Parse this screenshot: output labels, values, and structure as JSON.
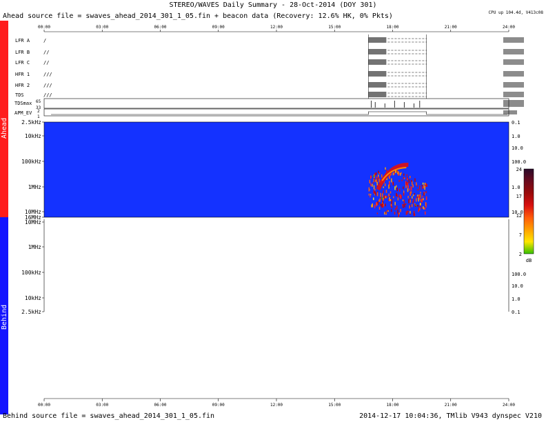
{
  "title": "STEREO/WAVES Daily Summary - 28-Oct-2014 (DOY 301)",
  "ahead_source": "Ahead source file = swaves_ahead_2014_301_1_05.fin + beacon data (Recovery: 12.6% HK,   0% Pkts)",
  "behind_source": "Behind source file = swaves_ahead_2014_301_1_05.fin",
  "footer_right": "2014-12-17 10:04:36, TMlib V943 dynspec V210",
  "cpu_info": "CPU up 104.4d, V413c08",
  "sidebar": {
    "ahead": "Ahead",
    "behind": "Behind",
    "ahead_color": "#ff1c1c",
    "behind_color": "#1414ff"
  },
  "time_ticks": [
    "00:00",
    "03:00",
    "06:00",
    "09:00",
    "12:00",
    "15:00",
    "18:00",
    "21:00",
    "24:00"
  ],
  "hk_rows": [
    {
      "label": "LFR A",
      "marks": "/"
    },
    {
      "label": "LFR B",
      "marks": "//"
    },
    {
      "label": "LFR C",
      "marks": "//"
    },
    {
      "label": "HFR 1",
      "marks": "///"
    },
    {
      "label": "HFR 2",
      "marks": "///"
    },
    {
      "label": "TDS",
      "marks": "///"
    }
  ],
  "tds_label": "TDSmax",
  "tds_ticks": [
    "65",
    "33"
  ],
  "apm_label": "APM_EV",
  "apm_ticks": [
    "2",
    "1"
  ],
  "chart_data": [
    {
      "type": "heatmap",
      "name": "Ahead",
      "x_range": [
        "00:00",
        "24:00"
      ],
      "y_ticks_left": [
        "2.5kHz",
        "10kHz",
        "100kHz",
        "1MHz",
        "10MHz",
        "16MHz"
      ],
      "y_ticks_right": [
        "0.1",
        "1.0",
        "10.0",
        "100.0",
        "1.0",
        "10.0"
      ],
      "background_color": "#1432ff",
      "events": [
        {
          "start": "16:45",
          "end": "19:45",
          "low_freq": "10MHz",
          "high_freq": "100kHz",
          "peak_db": 24
        }
      ]
    },
    {
      "type": "heatmap",
      "name": "Behind",
      "x_range": [
        "00:00",
        "24:00"
      ],
      "y_ticks_left": [
        "10MHz",
        "1MHz",
        "100kHz",
        "10kHz",
        "2.5kHz"
      ],
      "y_ticks_right": [
        "100.0",
        "10.0",
        "1.0",
        "0.1"
      ],
      "background_color": "#ffffff"
    }
  ],
  "colorbar": {
    "ticks": [
      "24",
      "17",
      "12",
      "7",
      "2"
    ],
    "unit": "dB",
    "colors": [
      "#2a0a2a",
      "#6a0a1e",
      "#9a0a0a",
      "#d81010",
      "#ff5a0a",
      "#ffa000",
      "#ffe600",
      "#34c000"
    ]
  }
}
